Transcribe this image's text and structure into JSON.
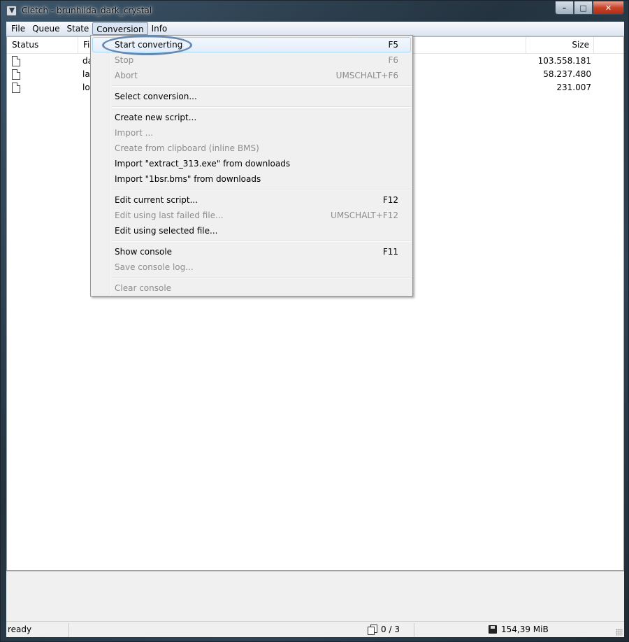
{
  "window": {
    "title": "Cletch - brunhilda_dark_crystal",
    "buttons": {
      "minimize": "–",
      "maximize": "□",
      "close": "✕"
    }
  },
  "menubar": {
    "items": [
      {
        "label": "File"
      },
      {
        "label": "Queue"
      },
      {
        "label": "State"
      },
      {
        "label": "Conversion"
      },
      {
        "label": "Info"
      }
    ]
  },
  "list": {
    "columns": {
      "status": "Status",
      "file": "Fil",
      "size": "Size"
    },
    "rows": [
      {
        "file": "da",
        "size": "103.558.181"
      },
      {
        "file": "lar",
        "size": "58.237.480"
      },
      {
        "file": "log",
        "size": "231.007"
      }
    ]
  },
  "conversion_menu": {
    "start": {
      "label": "Start converting",
      "key": "F5"
    },
    "stop": {
      "label": "Stop",
      "key": "F6"
    },
    "abort": {
      "label": "Abort",
      "key": "UMSCHALT+F6"
    },
    "select": {
      "label": "Select conversion..."
    },
    "create_new": {
      "label": "Create new script..."
    },
    "import": {
      "label": "Import ..."
    },
    "create_clipboard": {
      "label": "Create from clipboard (inline BMS)"
    },
    "import_extract": {
      "label": "Import \"extract_313.exe\" from downloads"
    },
    "import_1bsr": {
      "label": "Import \"1bsr.bms\" from downloads"
    },
    "edit_current": {
      "label": "Edit current script...",
      "key": "F12"
    },
    "edit_last_failed": {
      "label": "Edit using last failed file...",
      "key": "UMSCHALT+F12"
    },
    "edit_selected": {
      "label": "Edit using selected file..."
    },
    "show_console": {
      "label": "Show console",
      "key": "F11"
    },
    "save_console": {
      "label": "Save console log..."
    },
    "clear_console": {
      "label": "Clear console"
    }
  },
  "statusbar": {
    "state": "ready",
    "count": "0 / 3",
    "free_space": "154,39 MiB"
  },
  "icons": {
    "app": "app-icon",
    "file": "file-icon",
    "copy": "copy-icon",
    "disk": "disk-icon"
  },
  "colors": {
    "highlight_ellipse": "#6889b0",
    "menu_hover_border": "#a8d8f7",
    "close_button": "#c7442b"
  }
}
